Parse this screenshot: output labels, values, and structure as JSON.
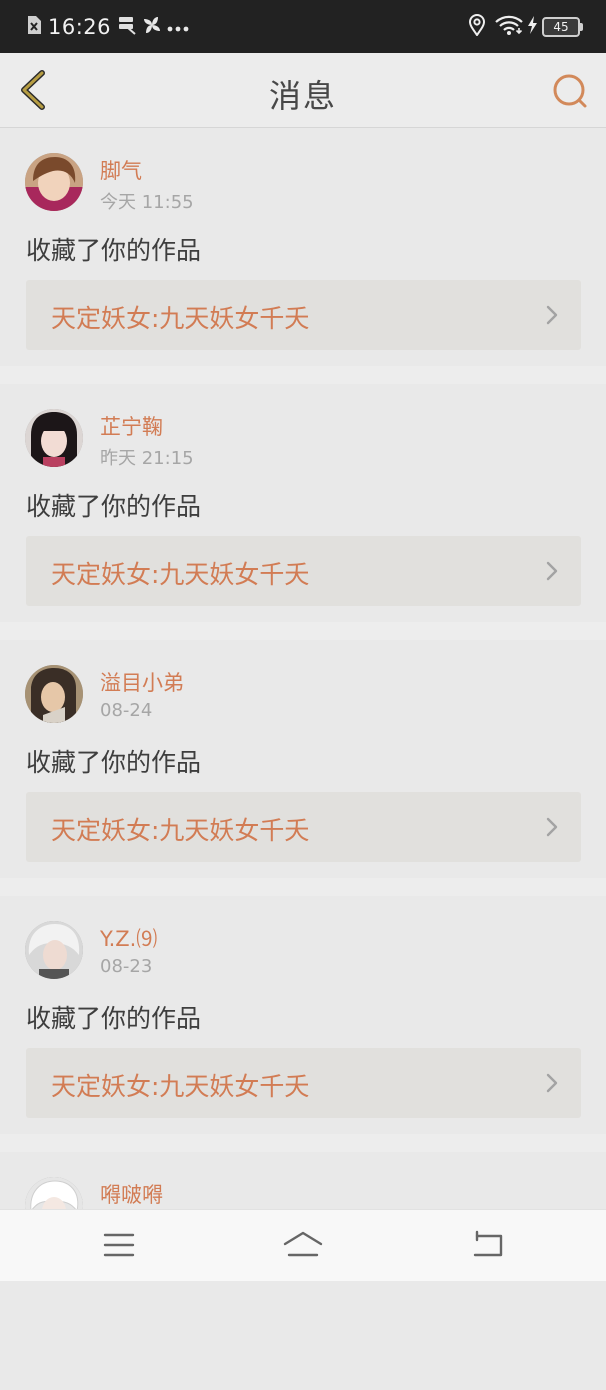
{
  "status_bar": {
    "time": "16:26",
    "battery": "45",
    "left_icons": [
      "sim-off-icon",
      "sd-card-icon",
      "pinwheel-icon",
      "more-dots-icon"
    ],
    "right_icons": [
      "location-icon",
      "wifi-icon",
      "charging-icon",
      "battery-icon"
    ]
  },
  "header": {
    "title": "消息",
    "back_icon": "chevron-left-icon",
    "search_icon": "search-icon",
    "accent_color": "#d2895a"
  },
  "messages": [
    {
      "username": "脚气",
      "time": "今天 11:55",
      "action": "收藏了你的作品",
      "work_title": "天定妖女:九天妖女千夭"
    },
    {
      "username": "芷宁鞠",
      "time": "昨天 21:15",
      "action": "收藏了你的作品",
      "work_title": "天定妖女:九天妖女千夭"
    },
    {
      "username": "溢目小弟",
      "time": "08-24",
      "action": "收藏了你的作品",
      "work_title": "天定妖女:九天妖女千夭"
    },
    {
      "username": "Y.Z.⑼",
      "time": "08-23",
      "action": "收藏了你的作品",
      "work_title": "天定妖女:九天妖女千夭"
    },
    {
      "username": "嘚啵嘚"
    }
  ],
  "nav": {
    "menu_icon": "menu-icon",
    "home_icon": "home-icon",
    "back_icon": "back-icon"
  },
  "colors": {
    "username": "#d27c54",
    "timestamp": "#a6a6a6",
    "card_background": "#e9e9e9",
    "page_background": "#ededed",
    "status_bar": "#222222"
  }
}
